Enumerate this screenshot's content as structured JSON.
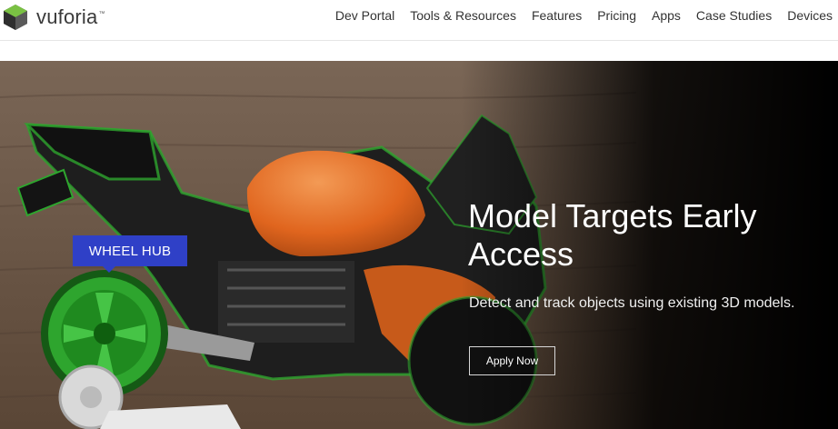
{
  "brand": {
    "name": "vuforia",
    "tm": "™"
  },
  "nav": {
    "items": [
      {
        "label": "Dev Portal"
      },
      {
        "label": "Tools & Resources"
      },
      {
        "label": "Features"
      },
      {
        "label": "Pricing"
      },
      {
        "label": "Apps"
      },
      {
        "label": "Case Studies"
      },
      {
        "label": "Devices"
      }
    ]
  },
  "hero": {
    "headline": "Model Targets Early Access",
    "subtext": "Detect and track objects using existing 3D models.",
    "cta_label": "Apply Now",
    "tag_label": "WHEEL HUB"
  },
  "colors": {
    "tag_blue": "#2f40c7",
    "highlight_green": "#2ea52e",
    "bike_orange": "#e0651e"
  }
}
